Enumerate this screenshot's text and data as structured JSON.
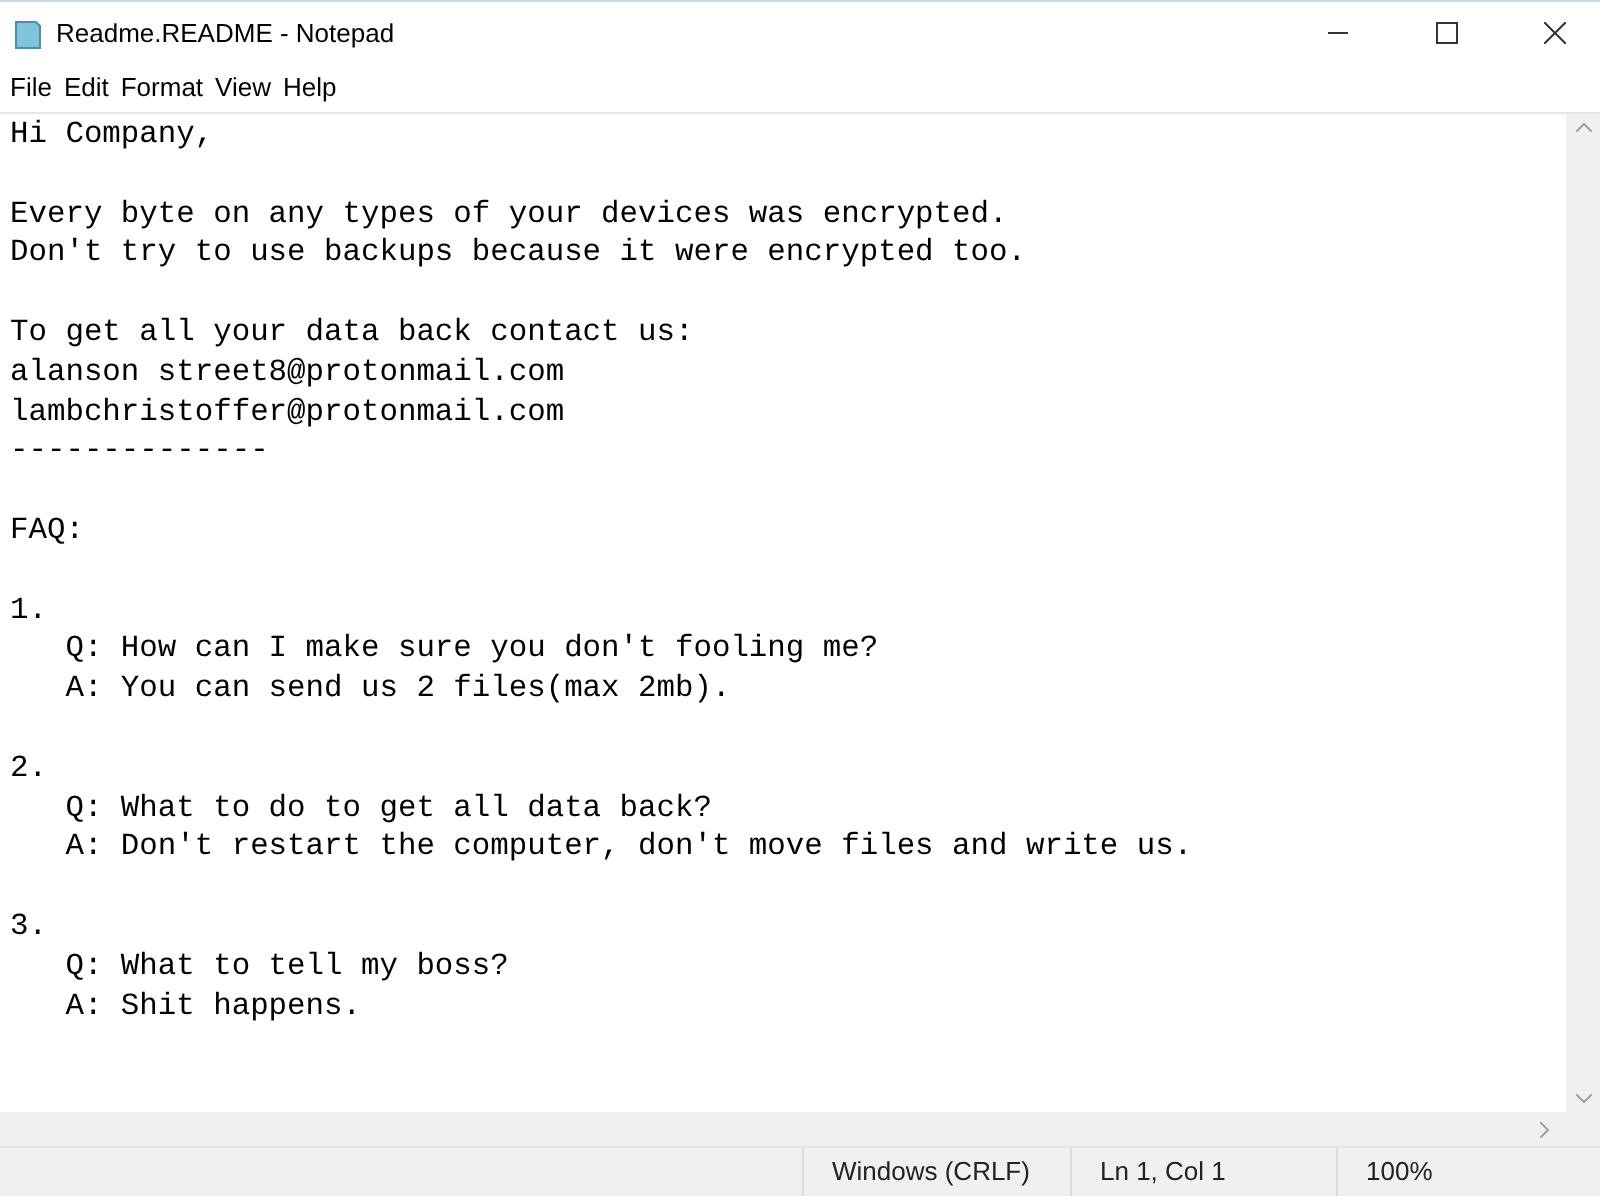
{
  "window": {
    "title": "Readme.README - Notepad"
  },
  "menu": [
    "File",
    "Edit",
    "Format",
    "View",
    "Help"
  ],
  "document": {
    "blocks": [
      [
        "Hi Company,"
      ],
      [
        "Every byte on any types of your devices was encrypted.",
        "Don't try to use backups because it were encrypted too."
      ],
      [
        "To get all your data back contact us:",
        "alanson street8@protonmail.com",
        "lambchristoffer@protonmail.com",
        "--------------"
      ],
      [
        "FAQ:"
      ],
      [
        "1.",
        "   Q: How can I make sure you don't fooling me?",
        "   A: You can send us 2 files(max 2mb)."
      ],
      [
        "2.",
        "   Q: What to do to get all data back?",
        "   A: Don't restart the computer, don't move files and write us."
      ],
      [
        "3.",
        "   Q: What to tell my boss?",
        "   A: Shit happens."
      ]
    ]
  },
  "status_bar": [
    "Windows (CRLF)",
    "Ln 1, Col 1",
    "100%"
  ]
}
